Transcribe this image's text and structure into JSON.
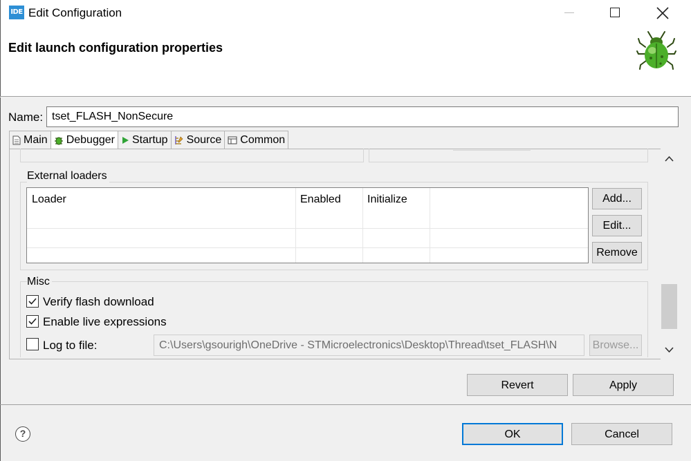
{
  "window": {
    "app_icon": "IDE",
    "title": "Edit Configuration"
  },
  "header": {
    "title": "Edit launch configuration properties",
    "icon": "green-bug-icon"
  },
  "name": {
    "label": "Name:",
    "value": "tset_FLASH_NonSecure"
  },
  "tabs": [
    {
      "label": "Main",
      "icon": "document-icon",
      "active": false
    },
    {
      "label": "Debugger",
      "icon": "bug-icon",
      "active": true
    },
    {
      "label": "Startup",
      "icon": "play-icon",
      "active": false
    },
    {
      "label": "Source",
      "icon": "source-icon",
      "active": false
    },
    {
      "label": "Common",
      "icon": "window-icon",
      "active": false
    }
  ],
  "external_loaders": {
    "group_label": "External loaders",
    "columns": [
      "Loader",
      "Enabled",
      "Initialize"
    ],
    "rows": [],
    "buttons": {
      "add": "Add...",
      "edit": "Edit...",
      "remove": "Remove"
    }
  },
  "misc": {
    "group_label": "Misc",
    "verify_flash": {
      "label": "Verify flash download",
      "checked": true
    },
    "live_expressions": {
      "label": "Enable live expressions",
      "checked": true
    },
    "log_to_file": {
      "label": "Log to file:",
      "checked": false,
      "path": "C:\\Users\\gsourigh\\OneDrive - STMicroelectronics\\Desktop\\Thread\\tset_FLASH\\N",
      "browse_label": "Browse..."
    }
  },
  "actions": {
    "revert": "Revert",
    "apply": "Apply"
  },
  "dialog": {
    "ok": "OK",
    "cancel": "Cancel",
    "help": "?"
  }
}
